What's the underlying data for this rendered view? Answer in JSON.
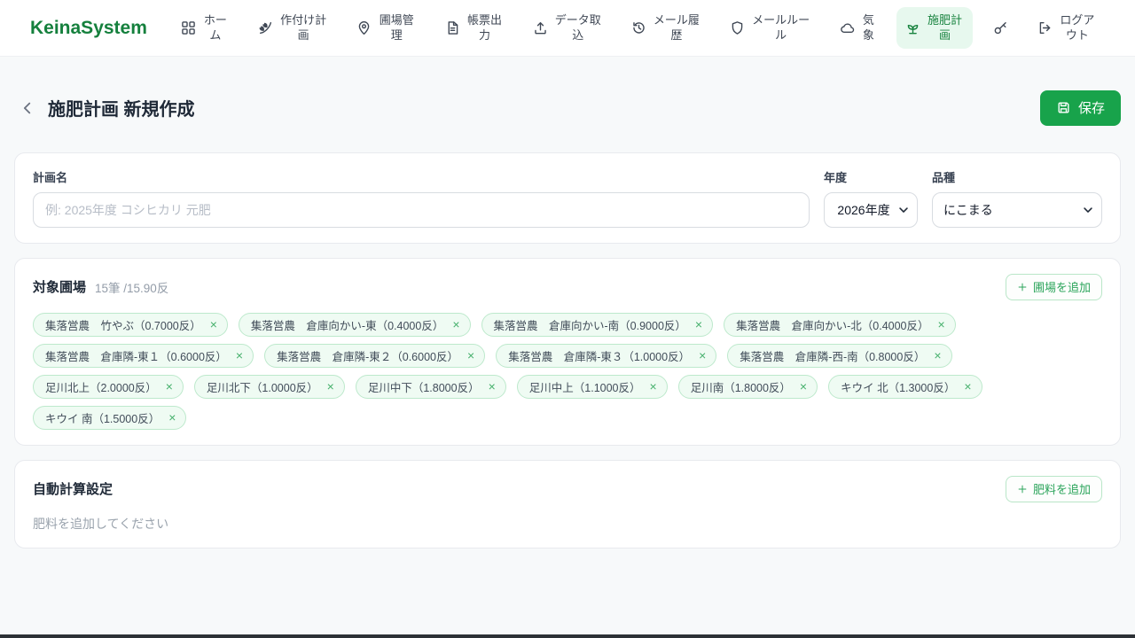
{
  "brand": {
    "name": "KeinaSystem"
  },
  "nav": {
    "items": [
      {
        "id": "home",
        "label": "ホーム",
        "icon": "grid-icon",
        "active": false
      },
      {
        "id": "planting-plan",
        "label": "作付け計画",
        "icon": "wheat-icon",
        "active": false
      },
      {
        "id": "field-management",
        "label": "圃場管理",
        "icon": "map-pin-icon",
        "active": false
      },
      {
        "id": "report-output",
        "label": "帳票出力",
        "icon": "document-icon",
        "active": false
      },
      {
        "id": "data-import",
        "label": "データ取込",
        "icon": "upload-icon",
        "active": false
      },
      {
        "id": "mail-history",
        "label": "メール履歴",
        "icon": "history-icon",
        "active": false
      },
      {
        "id": "mail-rules",
        "label": "メールルール",
        "icon": "shield-icon",
        "active": false
      },
      {
        "id": "weather",
        "label": "気象",
        "icon": "cloud-icon",
        "active": false
      },
      {
        "id": "fertilization-plan",
        "label": "施肥計画",
        "icon": "sprout-icon",
        "active": true
      },
      {
        "id": "api-key",
        "label": "",
        "icon": "key-icon",
        "active": false
      },
      {
        "id": "logout",
        "label": "ログアウト",
        "icon": "logout-icon",
        "active": false
      }
    ]
  },
  "page": {
    "title": "施肥計画 新規作成",
    "save_label": "保存"
  },
  "form": {
    "plan_name": {
      "label": "計画名",
      "value": "",
      "placeholder": "例: 2025年度 コシヒカリ 元肥"
    },
    "year": {
      "label": "年度",
      "value": "2026年度"
    },
    "variety": {
      "label": "品種",
      "value": "にこまる"
    }
  },
  "fields_section": {
    "title": "対象圃場",
    "summary": "15筆 /15.90反",
    "add_button": "圃場を追加",
    "chips": [
      "集落営農　竹やぶ（0.7000反）",
      "集落営農　倉庫向かい-東（0.4000反）",
      "集落営農　倉庫向かい-南（0.9000反）",
      "集落営農　倉庫向かい-北（0.4000反）",
      "集落営農　倉庫隣-東１（0.6000反）",
      "集落営農　倉庫隣-東２（0.6000反）",
      "集落営農　倉庫隣-東３（1.0000反）",
      "集落営農　倉庫隣-西-南（0.8000反）",
      "足川北上（2.0000反）",
      "足川北下（1.0000反）",
      "足川中下（1.8000反）",
      "足川中上（1.1000反）",
      "足川南（1.8000反）",
      "キウイ 北（1.3000反）",
      "キウイ 南（1.5000反）"
    ]
  },
  "auto_calc": {
    "title": "自動計算設定",
    "add_button": "肥料を追加",
    "empty_text": "肥料を追加してください"
  },
  "colors": {
    "brand_green": "#15803d",
    "primary_button": "#18a34b",
    "active_nav_bg": "#e7f8ee",
    "chip_bg": "#effbf3",
    "chip_border": "#bde9cc",
    "page_bg": "#f7f9fa"
  }
}
